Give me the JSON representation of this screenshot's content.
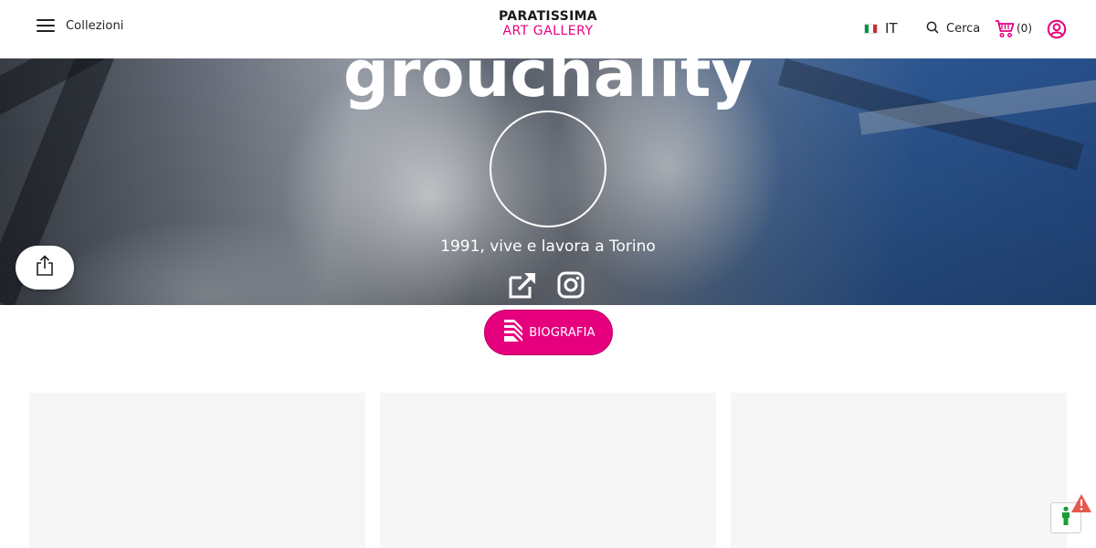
{
  "header": {
    "menu_label": "Collezioni",
    "logo_top": "PARATISSIMA",
    "logo_bottom": "ART GALLERY",
    "language": "IT",
    "search_label": "Cerca",
    "cart_count": "(0)",
    "icons": {
      "menu": "hamburger-icon",
      "flag": "italy-flag-icon",
      "search": "search-icon",
      "cart": "cart-icon",
      "user": "user-icon"
    }
  },
  "hero": {
    "title": "grouchality",
    "subtitle": "1991, vive e lavora a Torino",
    "links": [
      "external-link-icon",
      "instagram-icon"
    ]
  },
  "share": {
    "icon": "share-icon"
  },
  "biography": {
    "label": "BIOGRAFIA",
    "icon": "book-pages-icon"
  },
  "cards": [
    {
      "id": "card-1"
    },
    {
      "id": "card-2"
    },
    {
      "id": "card-3"
    }
  ],
  "colors": {
    "accent": "#e6007e",
    "card_bg": "#f6f6f6",
    "flag_green": "#009246",
    "flag_white": "#ffffff",
    "flag_red": "#ce2b37"
  }
}
